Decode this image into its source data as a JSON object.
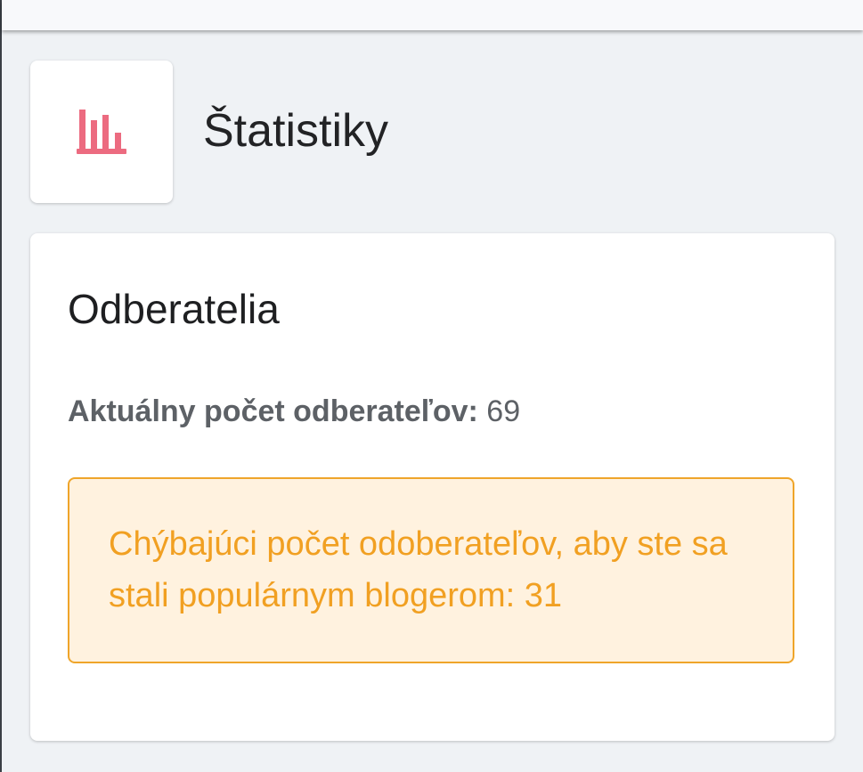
{
  "header": {
    "title": "Štatistiky",
    "icon": "bar-chart-icon",
    "icon_color": "#ec6b80"
  },
  "subscribers_card": {
    "title": "Odberatelia",
    "current_count_label": "Aktuálny počet odberateľov:",
    "current_count_value": "69",
    "warning_text": "Chýbajúci počet odoberateľov, aby ste sa stali populárnym blogerom: 31",
    "warning_color": "#f1a022",
    "warning_background": "#fff2df"
  },
  "colors": {
    "page_background": "#eff2f5",
    "card_background": "#ffffff",
    "title_text": "#222325",
    "muted_text": "#5d6166"
  }
}
